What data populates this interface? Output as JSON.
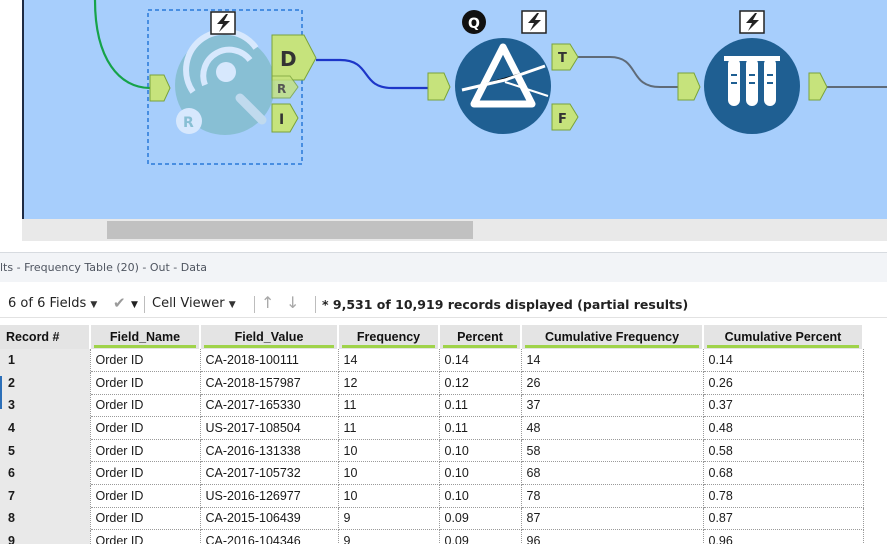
{
  "canvas": {
    "tools": {
      "r_tool": {
        "icon": "r-frequency-tool-icon",
        "outputs": [
          "D",
          "R",
          "I"
        ]
      },
      "filter_tool": {
        "icon": "filter-prism-icon",
        "outputs": [
          "T",
          "F"
        ],
        "badge": "Q"
      },
      "browse_tool": {
        "icon": "test-tubes-icon"
      }
    },
    "colors": {
      "canvas_bg": "#a7cefc",
      "anchor": "#c6e37c",
      "tool_blue": "#1f5f92",
      "conn_green": "#16a34a",
      "conn_blue": "#1d36c8"
    }
  },
  "results": {
    "title": "lts - Frequency Table (20) - Out - Data"
  },
  "toolbar": {
    "fields": "6 of 6 Fields",
    "viewer": "Cell Viewer",
    "records": "* 9,531 of 10,919 records displayed (partial results)"
  },
  "table": {
    "headers": [
      "Record #",
      "Field_Name",
      "Field_Value",
      "Frequency",
      "Percent",
      "Cumulative Frequency",
      "Cumulative Percent"
    ],
    "rows": [
      [
        "1",
        "Order ID",
        "CA-2018-100111",
        "14",
        "0.14",
        "14",
        "0.14"
      ],
      [
        "2",
        "Order ID",
        "CA-2018-157987",
        "12",
        "0.12",
        "26",
        "0.26"
      ],
      [
        "3",
        "Order ID",
        "CA-2017-165330",
        "11",
        "0.11",
        "37",
        "0.37"
      ],
      [
        "4",
        "Order ID",
        "US-2017-108504",
        "11",
        "0.11",
        "48",
        "0.48"
      ],
      [
        "5",
        "Order ID",
        "CA-2016-131338",
        "10",
        "0.10",
        "58",
        "0.58"
      ],
      [
        "6",
        "Order ID",
        "CA-2017-105732",
        "10",
        "0.10",
        "68",
        "0.68"
      ],
      [
        "7",
        "Order ID",
        "US-2016-126977",
        "10",
        "0.10",
        "78",
        "0.78"
      ],
      [
        "8",
        "Order ID",
        "CA-2015-106439",
        "9",
        "0.09",
        "87",
        "0.87"
      ],
      [
        "9",
        "Order ID",
        "CA-2016-104346",
        "9",
        "0.09",
        "96",
        "0.96"
      ]
    ]
  }
}
